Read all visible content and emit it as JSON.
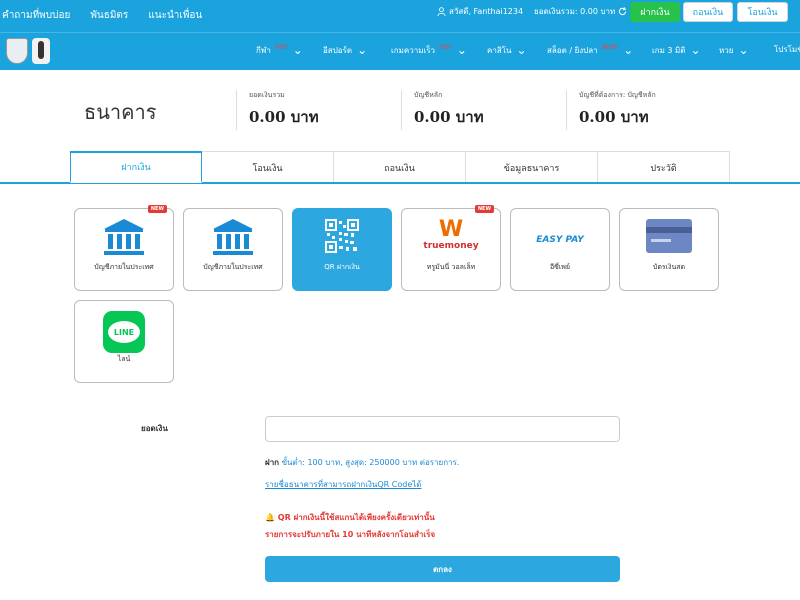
{
  "topbar": {
    "links": [
      "คำถามที่พบบ่อย",
      "พันธมิตร",
      "แนะนำเพื่อน"
    ],
    "greeting": "สวัสดี, Fanthai1234",
    "balance": "ยอดเงินรวม: 0.00 บาท",
    "deposit_label": "ฝากเงิน",
    "withdraw_label": "ถอนเงิน",
    "transfer_label": "โอนเงิน"
  },
  "nav": {
    "items": [
      {
        "label": "กีฬา",
        "badge": "HOT"
      },
      {
        "label": "อีสปอร์ต",
        "badge": ""
      },
      {
        "label": "เกมความเร็ว",
        "badge": "HOT"
      },
      {
        "label": "คาสิโน",
        "badge": ""
      },
      {
        "label": "สล็อต / ยิงปลา",
        "badge": "NEW!"
      },
      {
        "label": "เกม 3 มิติ",
        "badge": ""
      },
      {
        "label": "หวย",
        "badge": ""
      },
      {
        "label": "โปรโมชั่",
        "badge": ""
      }
    ]
  },
  "header": {
    "title": "ธนาคาร",
    "stats": [
      {
        "label": "ยอดเงินรวม",
        "value": "0.00 บาท"
      },
      {
        "label": "บัญชีหลัก",
        "value": "0.00 บาท"
      },
      {
        "label": "บัญชีที่ต้องการ: บัญชีหลัก",
        "value": "0.00 บาท"
      }
    ]
  },
  "tabs": [
    "ฝากเงิน",
    "โอนเงิน",
    "ถอนเงิน",
    "ข้อมูลธนาคาร",
    "ประวัติ"
  ],
  "methods": [
    {
      "label": "บัญชีภายในประเทศ",
      "badge": "NEW",
      "icon": "bank-icon"
    },
    {
      "label": "บัญชีภายในประเทศ",
      "badge": "",
      "icon": "bank-icon"
    },
    {
      "label": "QR ฝากเงิน",
      "badge": "",
      "icon": "qr-code-icon"
    },
    {
      "label": "ทรูมันนี่ วอลเล็ท",
      "badge": "NEW",
      "icon": "truemoney-icon",
      "logo_text": "truemoney"
    },
    {
      "label": "อีซี่เพย์",
      "badge": "",
      "icon": "easypay-icon",
      "logo_text": "EASY PAY"
    },
    {
      "label": "บัตรเงินสด",
      "badge": "",
      "icon": "cash-card-icon"
    },
    {
      "label": "ไลน์",
      "badge": "",
      "icon": "line-icon",
      "logo_text": "LINE"
    }
  ],
  "form": {
    "amount_label": "ยอดเงิน",
    "amount_value": "",
    "amount_placeholder": "",
    "limits_prefix": "ฝาก",
    "limits_text": "ขั้นต่ำ:  100 บาท,  สูงสุด:  250000 บาท ต่อรายการ.",
    "bank_link": "รายชื่อธนาคารที่สามารถฝากเงินQR Codeได้",
    "warning_1": "QR ฝากเงินนี้ใช้สแกนได้เพียงครั้งเดียวเท่านั้น",
    "warning_2": "รายการจะปรับภายใน 10 นาทีหลังจากโอนสำเร็จ",
    "submit_label": "ตกลง"
  },
  "colors": {
    "primary": "#1aa3dc",
    "deposit_button": "#27c24c",
    "active_card": "#2da7df",
    "warning": "#e53935",
    "line_green": "#06c755"
  }
}
